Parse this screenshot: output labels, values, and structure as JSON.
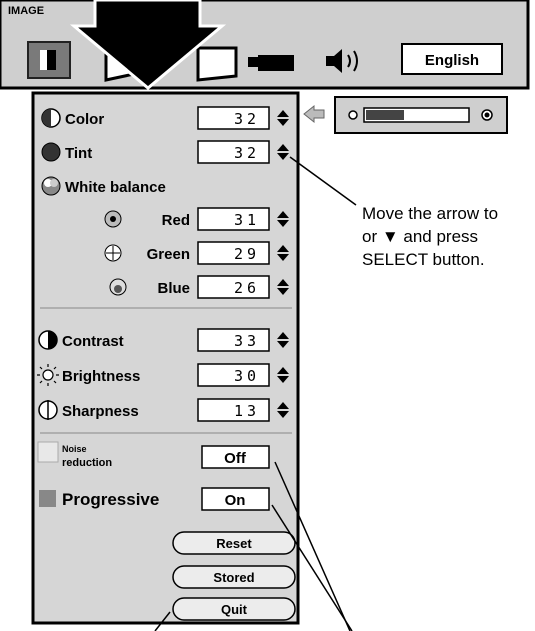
{
  "top_menu": {
    "title": "IMAGE",
    "language": "English"
  },
  "menu_items": [
    {
      "label": "Color",
      "value": "32",
      "icon": "color-icon"
    },
    {
      "label": "Tint",
      "value": "32",
      "icon": "tint-icon"
    },
    {
      "label": "White balance",
      "icon": "white-balance-icon"
    },
    {
      "label": "Red",
      "value": "31",
      "icon": "red-icon"
    },
    {
      "label": "Green",
      "value": "29",
      "icon": "green-icon"
    },
    {
      "label": "Blue",
      "value": "26",
      "icon": "blue-icon"
    },
    {
      "label": "Contrast",
      "value": "33",
      "icon": "contrast-icon"
    },
    {
      "label": "Brightness",
      "value": "30",
      "icon": "brightness-icon"
    },
    {
      "label": "Sharpness",
      "value": "13",
      "icon": "sharpness-icon"
    },
    {
      "label_line1": "Noise",
      "label_line2": "reduction",
      "value": "Off",
      "icon": "noise-icon"
    },
    {
      "label": "Progressive",
      "value": "On",
      "icon": "progressive-icon"
    }
  ],
  "buttons": {
    "reset": "Reset",
    "stored": "Stored",
    "quit": "Quit"
  },
  "annotation": {
    "line1": "Move the arrow to",
    "line2": "or ▼  and press",
    "line3": "SELECT button."
  },
  "colors": {
    "panel_bg": "#d6d6d6",
    "value_box": "#ffffff",
    "border": "#000000"
  }
}
